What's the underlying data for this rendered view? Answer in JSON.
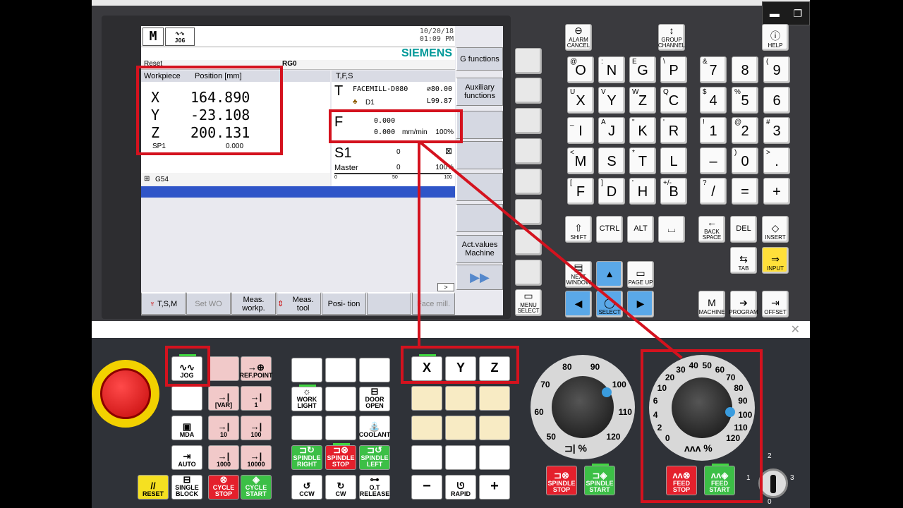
{
  "window_controls": {
    "minimize": "▬",
    "restore": "❐"
  },
  "hmi": {
    "date": "10/20/18",
    "time": "01:09 PM",
    "brand": "SIEMENS",
    "jog_label": "JOG",
    "mode_icon": "M",
    "reset_text": "Reset",
    "prog_frag": "RG0",
    "workpiece": {
      "header_col1": "Workpiece",
      "header_col2": "Position [mm]",
      "axes": [
        {
          "name": "X",
          "value": "164.890"
        },
        {
          "name": "Y",
          "value": "-23.108"
        },
        {
          "name": "Z",
          "value": "200.131"
        }
      ],
      "spindle_label": "SP1",
      "spindle_value": "0.000"
    },
    "tfs": {
      "header": "T,F,S",
      "tool_letter": "T",
      "tool_name": "FACEMILL-D080",
      "tool_dia": "⌀80.00",
      "d_label": "D1",
      "length": "L99.87",
      "f_letter": "F",
      "f_value1": "0.000",
      "f_value2": "0.000",
      "f_unit": "mm/min",
      "f_pct": "100%",
      "s_letter": "S1",
      "s_value": "0",
      "s_master": "Master",
      "s_value2": "0",
      "s_pct": "100%",
      "scale0": "0",
      "scale50": "50",
      "scale100": "100"
    },
    "offset": "G54",
    "vsoft": [
      "G functions",
      "Auxiliary functions",
      "",
      "",
      "",
      "",
      "Act.values Machine"
    ],
    "hsoft": [
      "T,S,M",
      "Set WO",
      "Meas. workp.",
      "Meas. tool",
      "Posi- tion",
      "",
      "Face mill."
    ],
    "more": ">"
  },
  "side_keys": {
    "menu_select": "MENU SELECT"
  },
  "keyboard": {
    "alarm_cancel": "ALARM CANCEL",
    "group_channel": "GROUP CHANNEL",
    "help": "HELP",
    "letters": [
      {
        "k": "O",
        "s": "@"
      },
      {
        "k": "N",
        "s": ":"
      },
      {
        "k": "G",
        "s": "E"
      },
      {
        "k": "P",
        "s": "\\"
      },
      {
        "k": "X",
        "s": "U"
      },
      {
        "k": "Y",
        "s": "V"
      },
      {
        "k": "Z",
        "s": "W"
      },
      {
        "k": "C",
        "s": "Q"
      },
      {
        "k": "I",
        "s": "_"
      },
      {
        "k": "J",
        "s": "A"
      },
      {
        "k": "K",
        "s": "\""
      },
      {
        "k": "R",
        "s": "'"
      },
      {
        "k": "M",
        "s": "<"
      },
      {
        "k": "S",
        "s": ""
      },
      {
        "k": "T",
        "s": "*"
      },
      {
        "k": "L",
        "s": ""
      },
      {
        "k": "F",
        "s": "["
      },
      {
        "k": "D",
        "s": "]"
      },
      {
        "k": "H",
        "s": "'"
      },
      {
        "k": "B",
        "s": "+/-"
      }
    ],
    "numbers": [
      {
        "k": "7",
        "s": "&"
      },
      {
        "k": "8",
        "s": ""
      },
      {
        "k": "9",
        "s": "("
      },
      {
        "k": "4",
        "s": "$"
      },
      {
        "k": "5",
        "s": "%"
      },
      {
        "k": "6",
        "s": ""
      },
      {
        "k": "1",
        "s": "!"
      },
      {
        "k": "2",
        "s": "@"
      },
      {
        "k": "3",
        "s": "#"
      },
      {
        "k": "–",
        "s": ""
      },
      {
        "k": "0",
        "s": ")"
      },
      {
        "k": ".",
        "s": ">"
      },
      {
        "k": "/",
        "s": "?"
      },
      {
        "k": "=",
        "s": ""
      },
      {
        "k": "+",
        "s": ""
      }
    ],
    "shift": "SHIFT",
    "ctrl": "CTRL",
    "alt": "ALT",
    "back_space": "BACK SPACE",
    "del": "DEL",
    "insert": "INSERT",
    "tab": "TAB",
    "input": "INPUT",
    "next_window": "NEXT WINDOW",
    "page_up": "PAGE UP",
    "select": "SELECT",
    "machine": "MACHINE",
    "program": "PROGRAM",
    "offset": "OFFSET"
  },
  "op_panel": {
    "jog": "JOG",
    "ref_point": "REF.POINT",
    "var": "[VAR]",
    "one": "1",
    "mda": "MDA",
    "ten": "10",
    "hundred": "100",
    "auto": "AUTO",
    "thousand": "1000",
    "tenthousand": "10000",
    "reset": "RESET",
    "single_block": "SINGLE BLOCK",
    "cycle_stop": "CYCLE STOP",
    "cycle_start": "CYCLE START",
    "work_light": "WORK LIGHT",
    "door_open": "DOOR OPEN",
    "coolant": "COOLANT",
    "spindle_right": "SPINDLE RIGHT",
    "spindle_stop": "SPINDLE STOP",
    "spindle_left": "SPINDLE LEFT",
    "ccw": "CCW",
    "cw": "CW",
    "ot_release": "O.T RELEASE",
    "x": "X",
    "y": "Y",
    "z": "Z",
    "minus": "−",
    "rapid": "RAPID",
    "plus": "+",
    "spindle_dial": {
      "labels": [
        "50",
        "60",
        "70",
        "80",
        "90",
        "100",
        "110",
        "120"
      ],
      "unit": "%",
      "level_pct": 100
    },
    "feed_dial": {
      "labels": [
        "0",
        "2",
        "4",
        "6",
        "10",
        "20",
        "30",
        "40",
        "50",
        "60",
        "70",
        "80",
        "90",
        "100",
        "110",
        "120"
      ],
      "unit": "%",
      "level_pct": 100
    },
    "spindle_stop2": "SPINDLE STOP",
    "spindle_start": "SPINDLE START",
    "feed_stop": "FEED STOP",
    "feed_start": "FEED START",
    "key_positions": [
      "0",
      "1",
      "2",
      "3"
    ]
  }
}
